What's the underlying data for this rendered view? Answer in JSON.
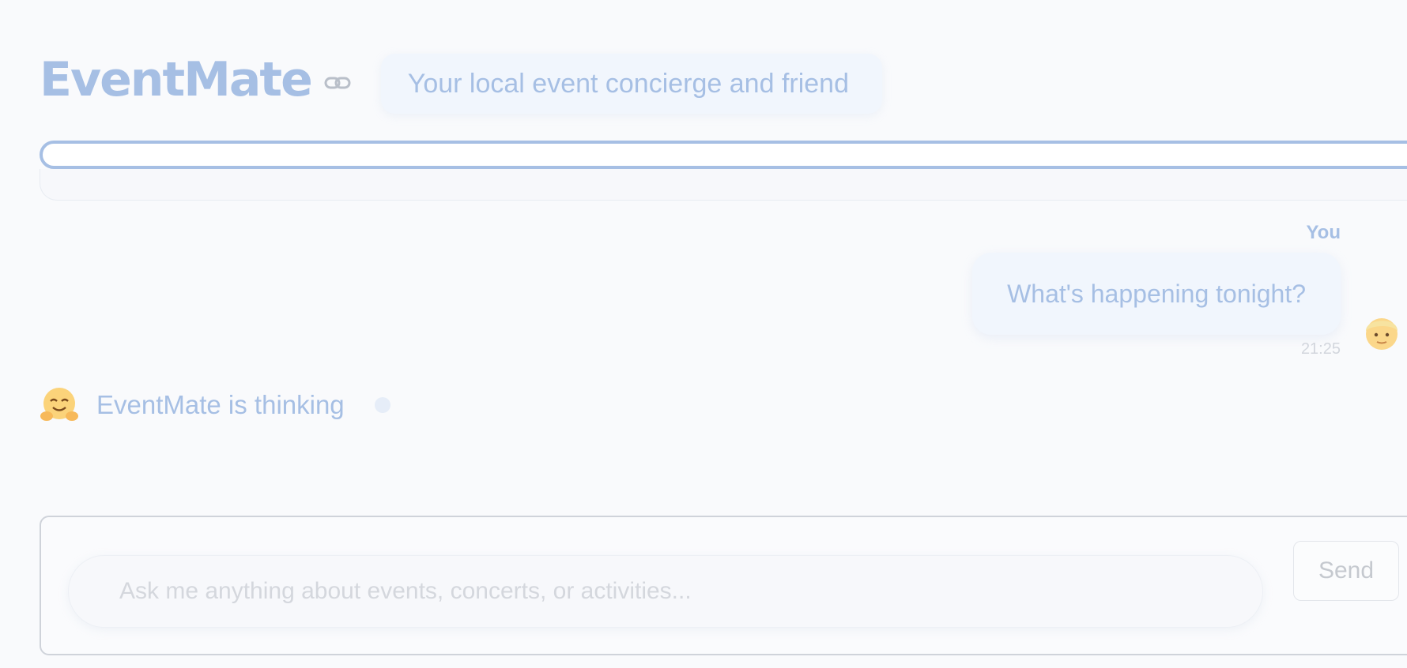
{
  "header": {
    "title": "EventMate",
    "link_icon": "link-icon",
    "tagline": "Your local event concierge and friend"
  },
  "progress": {
    "value": 0
  },
  "chat": {
    "messages": [
      {
        "sender": "You",
        "text": "What's happening tonight?",
        "time": "21:25",
        "avatar": "person-emoji-icon"
      }
    ],
    "status": {
      "avatar": "hugging-face-emoji-icon",
      "text": "EventMate is thinking"
    }
  },
  "composer": {
    "placeholder": "Ask me anything about events, concerts, or activities...",
    "value": "",
    "send_label": "Send"
  },
  "colors": {
    "accent": "#a6bfe4",
    "bubble": "#f1f6fd",
    "background": "#f9fafc"
  }
}
